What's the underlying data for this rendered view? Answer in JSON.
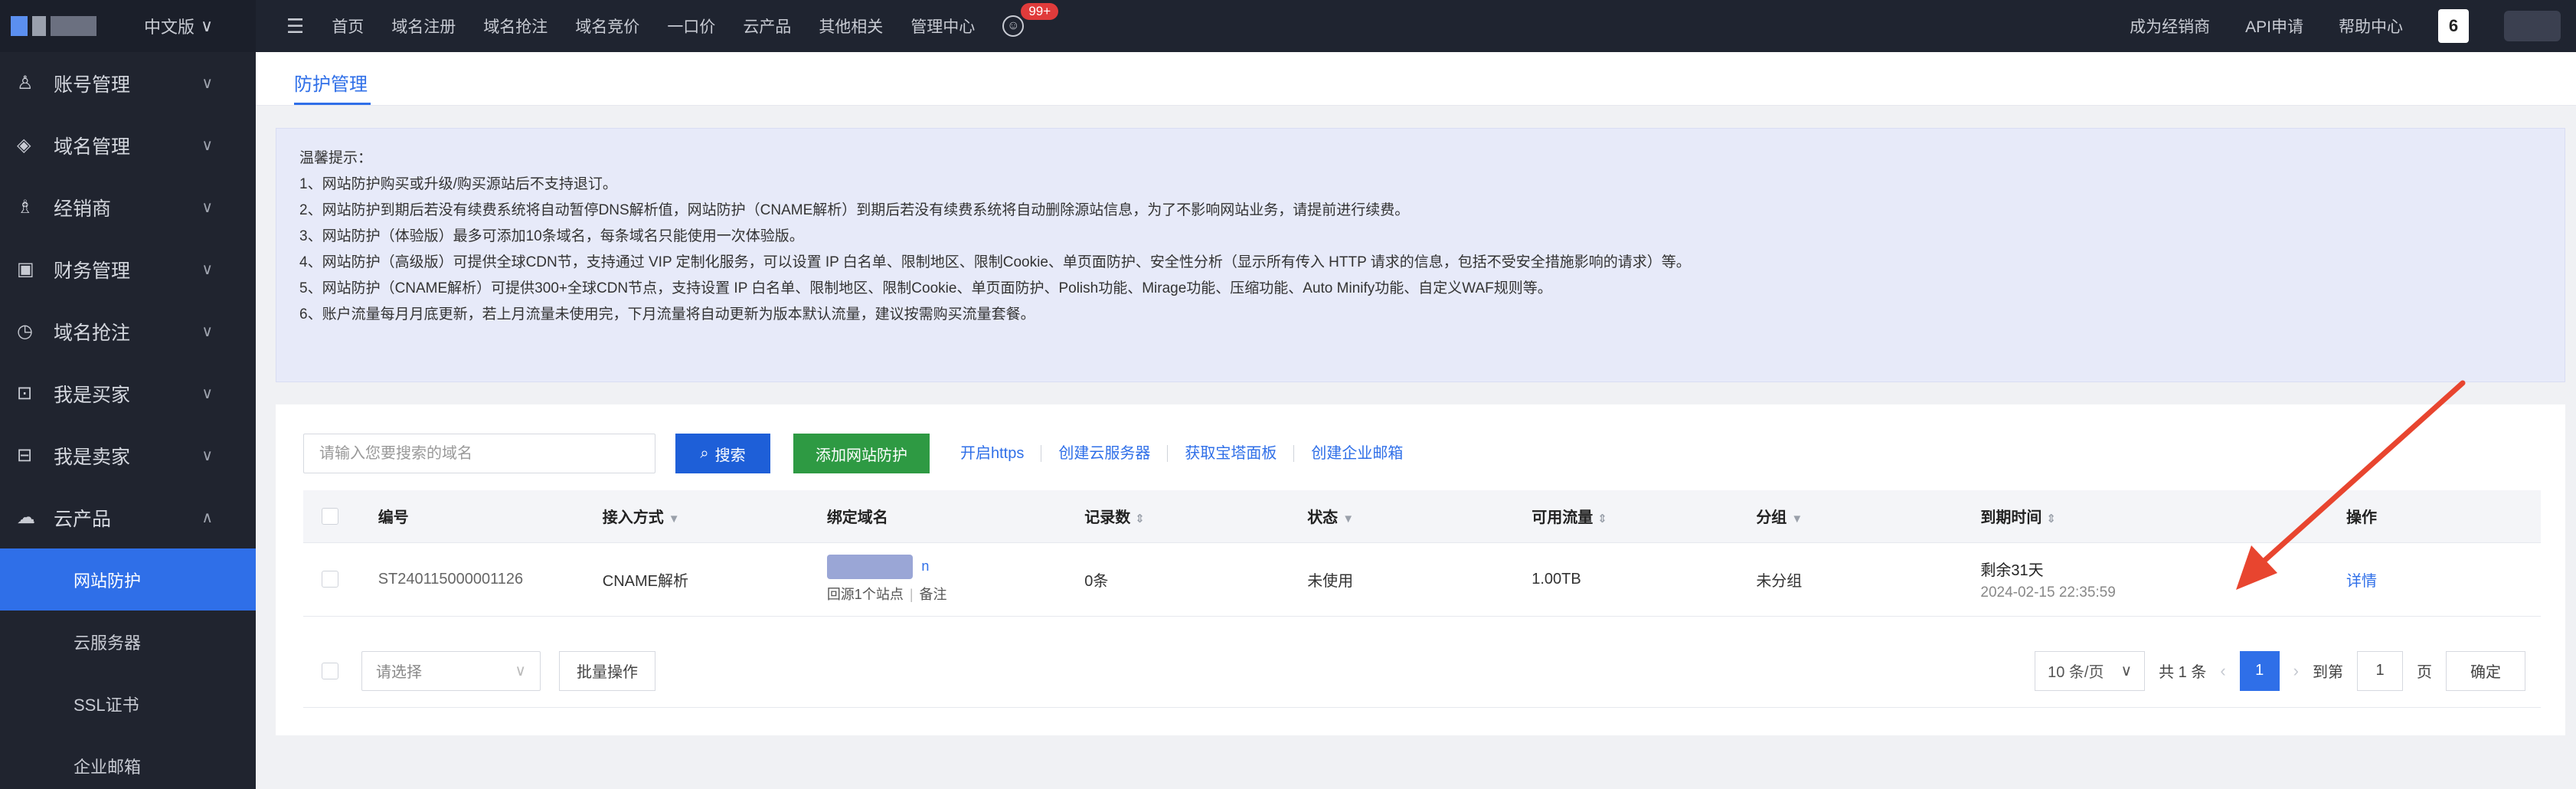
{
  "topbar": {
    "lang": "中文版",
    "nav": [
      "首页",
      "域名注册",
      "域名抢注",
      "域名竞价",
      "一口价",
      "云产品",
      "其他相关",
      "管理中心"
    ],
    "badge": "99+",
    "right": [
      "成为经销商",
      "API申请",
      "帮助中心"
    ],
    "avatar_text": "6"
  },
  "sidebar": {
    "items": [
      {
        "icon": "user-icon",
        "glyph": "♙",
        "label": "账号管理",
        "chev": "∨"
      },
      {
        "icon": "layers-icon",
        "glyph": "◈",
        "label": "域名管理",
        "chev": "∨"
      },
      {
        "icon": "partner-icon",
        "glyph": "♗",
        "label": "经销商",
        "chev": "∨"
      },
      {
        "icon": "finance-icon",
        "glyph": "▣",
        "label": "财务管理",
        "chev": "∨"
      },
      {
        "icon": "clock-icon",
        "glyph": "◷",
        "label": "域名抢注",
        "chev": "∨"
      },
      {
        "icon": "cart-icon",
        "glyph": "⊡",
        "label": "我是买家",
        "chev": "∨"
      },
      {
        "icon": "shop-icon",
        "glyph": "⊟",
        "label": "我是卖家",
        "chev": "∨"
      },
      {
        "icon": "cloud-icon",
        "glyph": "☁",
        "label": "云产品",
        "chev": "∧"
      }
    ],
    "subitems": [
      "网站防护",
      "云服务器",
      "SSL证书",
      "企业邮箱"
    ]
  },
  "main": {
    "tab": "防护管理"
  },
  "notice": {
    "title": "温馨提示：",
    "lines": [
      "1、网站防护购买或升级/购买源站后不支持退订。",
      "2、网站防护到期后若没有续费系统将自动暂停DNS解析值，网站防护（CNAME解析）到期后若没有续费系统将自动删除源站信息，为了不影响网站业务，请提前进行续费。",
      "3、网站防护（体验版）最多可添加10条域名，每条域名只能使用一次体验版。",
      "4、网站防护（高级版）可提供全球CDN节，支持通过 VIP 定制化服务，可以设置 IP 白名单、限制地区、限制Cookie、单页面防护、安全性分析（显示所有传入 HTTP 请求的信息，包括不受安全措施影响的请求）等。",
      "5、网站防护（CNAME解析）可提供300+全球CDN节点，支持设置 IP 白名单、限制地区、限制Cookie、单页面防护、Polish功能、Mirage功能、压缩功能、Auto Minify功能、自定义WAF规则等。",
      "6、账户流量每月月底更新，若上月流量未使用完，下月流量将自动更新为版本默认流量，建议按需购买流量套餐。"
    ]
  },
  "toolbar": {
    "search_placeholder": "请输入您要搜索的域名",
    "search_label": "搜索",
    "add_label": "添加网站防护",
    "links": [
      "开启https",
      "创建云服务器",
      "获取宝塔面板",
      "创建企业邮箱"
    ]
  },
  "table": {
    "headers": {
      "id": "编号",
      "access": "接入方式",
      "domain": "绑定域名",
      "records": "记录数",
      "status": "状态",
      "traffic": "可用流量",
      "group": "分组",
      "expire": "到期时间",
      "ops": "操作"
    },
    "row": {
      "id": "ST240115000001126",
      "access": "CNAME解析",
      "domain_suffix": "n",
      "domain_sub1": "回源1个站点",
      "domain_sub2": "备注",
      "records": "0条",
      "status": "未使用",
      "traffic": "1.00TB",
      "group": "未分组",
      "expire_remain": "剩余31天",
      "expire_date": "2024-02-15 22:35:59",
      "op": "详情"
    }
  },
  "footer": {
    "select_placeholder": "请选择",
    "batch_label": "批量操作",
    "page_size": "10 条/页",
    "total": "共 1 条",
    "page": "1",
    "goto_label": "到第",
    "goto_value": "1",
    "page_unit": "页",
    "confirm": "确定"
  },
  "colors": {
    "topbar": "#1f2430",
    "sidebar": "#20242f",
    "primary": "#2f6fe8",
    "success": "#2e9a43",
    "warning": "#e8a33a",
    "notice_bg": "#e7eaf9",
    "annotation_arrow": "#e8452f"
  }
}
